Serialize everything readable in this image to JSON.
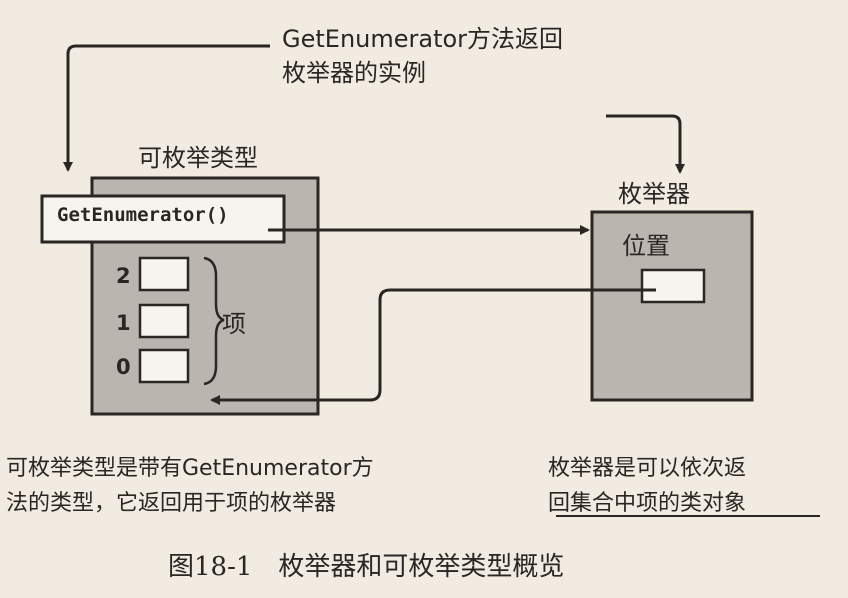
{
  "diagram": {
    "callout": {
      "line1": "GetEnumerator方法返回",
      "line2": "枚举器的实例"
    },
    "enumerable": {
      "title": "可枚举类型",
      "method": "GetEnumerator()",
      "items_label": "项",
      "indices": [
        "2",
        "1",
        "0"
      ]
    },
    "enumerator": {
      "title": "枚举器",
      "position_label": "位置"
    },
    "descriptions": {
      "left_line1": "可枚举类型是带有GetEnumerator方",
      "left_line2": "法的类型，它返回用于项的枚举器",
      "right_line1": "枚举器是可以依次返",
      "right_line2": "回集合中项的类对象"
    },
    "caption": "图18-1　枚举器和可枚举类型概览"
  }
}
